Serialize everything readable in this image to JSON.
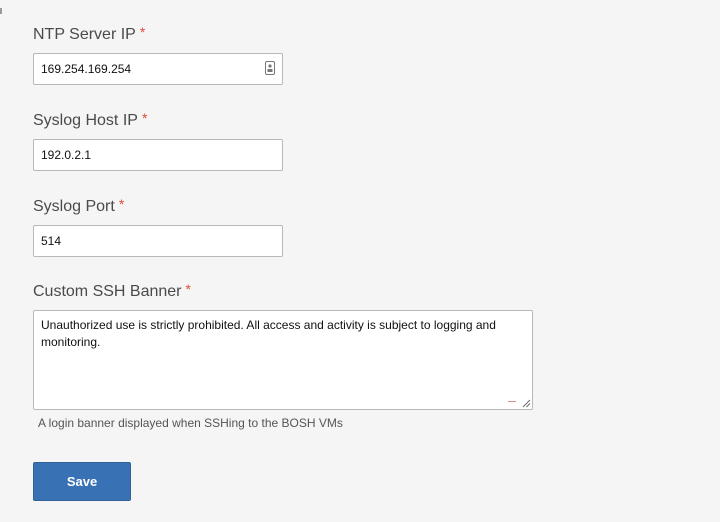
{
  "form": {
    "ntp": {
      "label": "NTP Server IP",
      "required_mark": "*",
      "value": "169.254.169.254",
      "icon": "password-manager-icon"
    },
    "syslog_host": {
      "label": "Syslog Host IP",
      "required_mark": "*",
      "value": "192.0.2.1"
    },
    "syslog_port": {
      "label": "Syslog Port",
      "required_mark": "*",
      "value": "514"
    },
    "ssh_banner": {
      "label": "Custom SSH Banner",
      "required_mark": "*",
      "value": "Unauthorized use is strictly prohibited. All access and activity is subject to logging and monitoring.",
      "helper": "A login banner displayed when SSHing to the BOSH VMs"
    },
    "save_label": "Save"
  },
  "colors": {
    "background": "#f5f5f5",
    "required": "#e04a3b",
    "button": "#3872b4",
    "button_text": "#ffffff"
  }
}
